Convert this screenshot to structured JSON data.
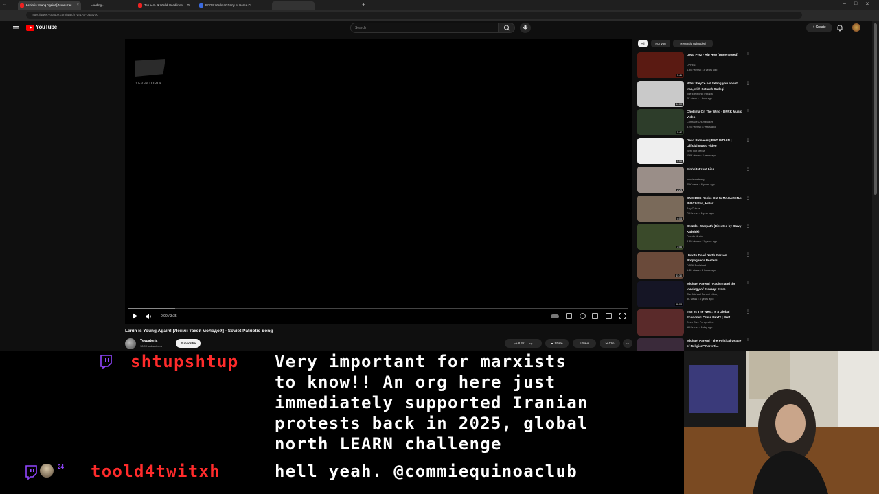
{
  "browser": {
    "tabs": [
      {
        "title": "Lenin is Young Again! [Ленин так",
        "active": true
      },
      {
        "title": "Loading...",
        "active": false
      },
      {
        "title": "Top U.S. & World Headlines — Tr",
        "active": false
      },
      {
        "title": "DPRK Workers' Party of Korea Pr",
        "active": false
      }
    ],
    "url": "https://www.youtube.com/watch?v=1Ak-Ujp3Vp0"
  },
  "youtube": {
    "logo": "YouTube",
    "search_placeholder": "Search",
    "create_label": "Create",
    "video": {
      "watermark": "YEVPATORIA",
      "timecode": "0:00 / 3:35",
      "title": "Lenin is Young Again! [Ленин такой молодой] - Soviet Patriotic Song",
      "channel": "Yevpatoria",
      "subscribers": "18.9K subscribers",
      "subscribe_label": "Subscribe",
      "likes": "8.3K",
      "share_label": "Share",
      "save_label": "Save",
      "clip_label": "Clip"
    },
    "chips": [
      "All",
      "For you",
      "Recently uploaded"
    ],
    "recommendations": [
      {
        "title": "Dead Prez - Hip Hop (Uncensored)",
        "channel": "DPREZ",
        "meta": "1.9M views • 14 years ago",
        "duration": "3:41",
        "color": "#5a1a12"
      },
      {
        "title": "What they're not telling you about Iran, with Setareh Sadeqi",
        "channel": "The Electronic Intifada",
        "meta": "2K views • 1 hour ago",
        "duration": "44:09",
        "color": "#c9c9c9"
      },
      {
        "title": "Chollima On The Wing - DPRK Music Video",
        "channel": "Comrade Chumbucket",
        "meta": "5.7M views • 8 years ago",
        "duration": "3:42",
        "color": "#2d3d2a"
      },
      {
        "title": "Dead Pioneers | BAD INDIAN | Official Music Video",
        "channel": "Nerd Rot Media",
        "meta": "116K views • 2 years ago",
        "duration": "3:53",
        "color": "#eeeeee"
      },
      {
        "title": "EinheitsFront Lied",
        "channel": "bernlarmstrong",
        "meta": "25K views • 6 years ago",
        "duration": "2:24",
        "color": "#9a8e88"
      },
      {
        "title": "DNC 1996 Rocks Out to MACARENA: Bill Clinton, Hillar...",
        "channel": "Bay Culture",
        "meta": "70K views • 1 year ago",
        "duration": "4:05",
        "color": "#7a6a5a"
      },
      {
        "title": "Drozdo - Warpath (Directed by Stavy Kabrick)",
        "channel": "Drozdo Music",
        "meta": "3.8M views • 11 years ago",
        "duration": "3:56",
        "color": "#3a4a2a"
      },
      {
        "title": "How to Read North Korean Propaganda Posters",
        "channel": "DPRK Explained",
        "meta": "1.3K views • 8 hours ago",
        "duration": "31:30",
        "color": "#6a4a3a"
      },
      {
        "title": "Michael Parenti \"Racism and the Ideology of Slavery: From ...",
        "channel": "The Michael Parenti Library",
        "meta": "3K views • 3 years ago",
        "duration": "58:03",
        "color": "#151525"
      },
      {
        "title": "Iran vs The West: Is a Global Economic Crisis Next? | Prof ...",
        "channel": "Deep Dive Perspective",
        "meta": "12K views • 1 day ago",
        "duration": "",
        "color": "#5a2a2a"
      },
      {
        "title": "Michael Parenti \"The Political Usage of Religion\" Parenti...",
        "channel": "",
        "meta": "",
        "duration": "",
        "color": "#3a2a3a"
      }
    ]
  },
  "chat": [
    {
      "user": "shtupshtup",
      "lines": [
        "Very important for marxists",
        "to know!! An org here just",
        "immediately supported Iranian",
        "protests back in 2025, global",
        "north LEARN challenge"
      ]
    },
    {
      "user": "toold4twitxh",
      "lines": [
        "hell yeah. @commiequinoaclub"
      ]
    }
  ],
  "badge_text": "24",
  "colors": {
    "yt_bg": "#0f0f0f",
    "accent_red": "#ff0000",
    "chat_user": "#ff2b2b",
    "twitch_purple": "#9146ff"
  }
}
